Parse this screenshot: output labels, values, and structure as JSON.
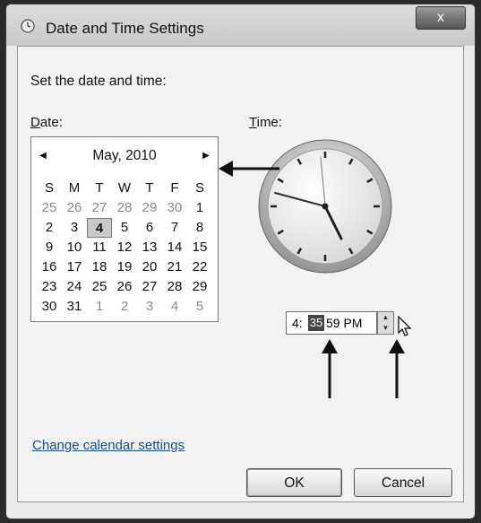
{
  "window": {
    "title": "Date and Time Settings",
    "close_label": "x"
  },
  "instruction": "Set the date and time:",
  "date_label": {
    "hotkey": "D",
    "rest": "ate:"
  },
  "time_label": {
    "hotkey": "T",
    "rest": "ime:"
  },
  "calendar": {
    "month_year": "May, 2010",
    "prev_icon": "left-triangle-icon",
    "next_icon": "right-triangle-icon",
    "weekdays": [
      "S",
      "M",
      "T",
      "W",
      "T",
      "F",
      "S"
    ],
    "days": [
      {
        "d": "25",
        "other": true
      },
      {
        "d": "26",
        "other": true
      },
      {
        "d": "27",
        "other": true
      },
      {
        "d": "28",
        "other": true
      },
      {
        "d": "29",
        "other": true
      },
      {
        "d": "30",
        "other": true
      },
      {
        "d": "1"
      },
      {
        "d": "2"
      },
      {
        "d": "3"
      },
      {
        "d": "4",
        "today": true
      },
      {
        "d": "5"
      },
      {
        "d": "6"
      },
      {
        "d": "7"
      },
      {
        "d": "8"
      },
      {
        "d": "9"
      },
      {
        "d": "10"
      },
      {
        "d": "11"
      },
      {
        "d": "12"
      },
      {
        "d": "13"
      },
      {
        "d": "14"
      },
      {
        "d": "15"
      },
      {
        "d": "16"
      },
      {
        "d": "17"
      },
      {
        "d": "18"
      },
      {
        "d": "19"
      },
      {
        "d": "20"
      },
      {
        "d": "21"
      },
      {
        "d": "22"
      },
      {
        "d": "23"
      },
      {
        "d": "24"
      },
      {
        "d": "25"
      },
      {
        "d": "26"
      },
      {
        "d": "27"
      },
      {
        "d": "28"
      },
      {
        "d": "29"
      },
      {
        "d": "30"
      },
      {
        "d": "31"
      },
      {
        "d": "1",
        "other": true
      },
      {
        "d": "2",
        "other": true
      },
      {
        "d": "3",
        "other": true
      },
      {
        "d": "4",
        "other": true
      },
      {
        "d": "5",
        "other": true
      }
    ]
  },
  "time": {
    "hour": "4:",
    "minute": "35",
    "rest": "59 PM"
  },
  "change_calendar_link": "Change calendar settings",
  "buttons": {
    "ok": "OK",
    "cancel": "Cancel"
  }
}
